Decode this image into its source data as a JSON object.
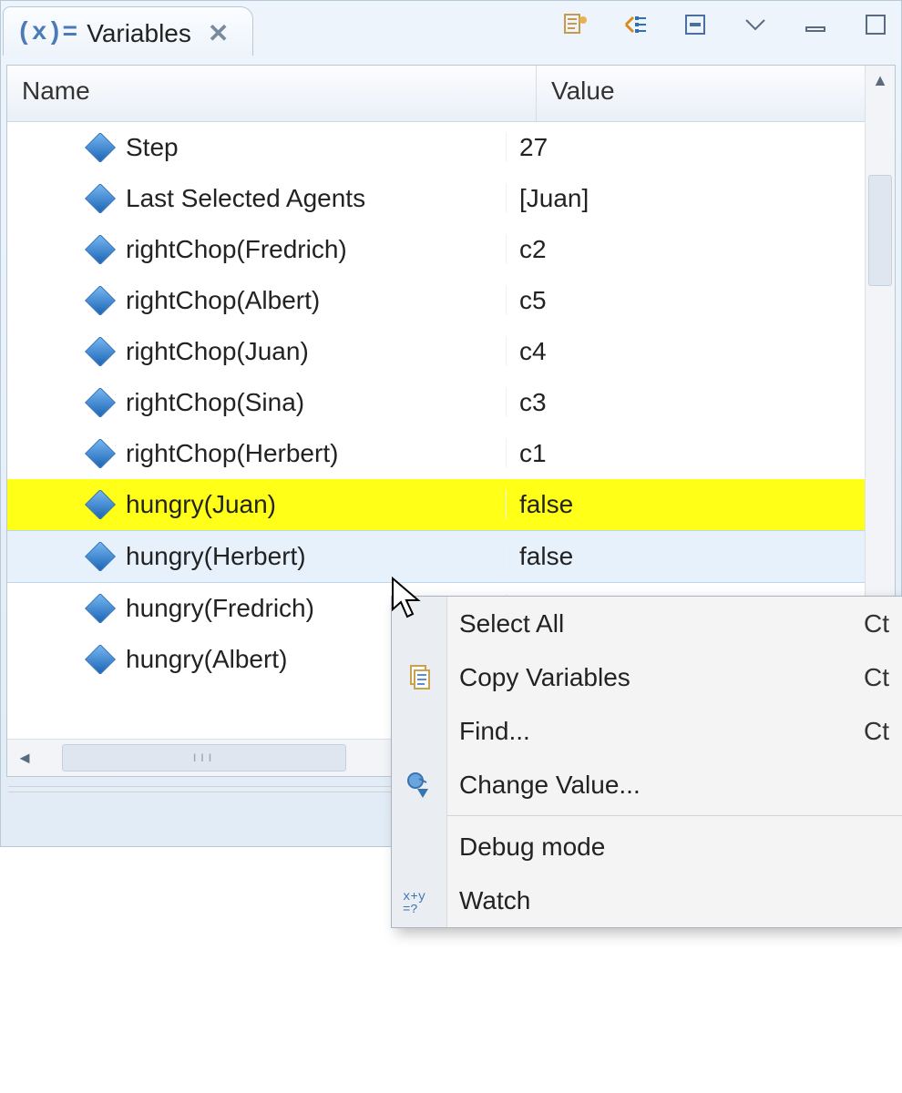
{
  "tab": {
    "title": "Variables",
    "icon": "(x)="
  },
  "toolbar": {
    "logical_structure": "show-logical-structure",
    "collapse_all": "collapse-all",
    "menu": "view-menu",
    "min": "minimize",
    "max": "maximize"
  },
  "columns": {
    "name": "Name",
    "value": "Value"
  },
  "rows": [
    {
      "name": "Step",
      "value": "27"
    },
    {
      "name": "Last Selected Agents",
      "value": "[Juan]"
    },
    {
      "name": "rightChop(Fredrich)",
      "value": "c2"
    },
    {
      "name": "rightChop(Albert)",
      "value": "c5"
    },
    {
      "name": "rightChop(Juan)",
      "value": "c4"
    },
    {
      "name": "rightChop(Sina)",
      "value": "c3"
    },
    {
      "name": "rightChop(Herbert)",
      "value": "c1"
    },
    {
      "name": "hungry(Juan)",
      "value": "false",
      "hl": true
    },
    {
      "name": "hungry(Herbert)",
      "value": "false",
      "sel": true
    },
    {
      "name": "hungry(Fredrich)",
      "value": ""
    },
    {
      "name": "hungry(Albert)",
      "value": ""
    }
  ],
  "context_menu": {
    "items": [
      {
        "icon": "",
        "label": "Select All",
        "shortcut": "Ct"
      },
      {
        "icon": "copy",
        "label": "Copy Variables",
        "shortcut": "Ct"
      },
      {
        "icon": "",
        "label": "Find...",
        "shortcut": "Ct"
      },
      {
        "icon": "change",
        "label": "Change Value...",
        "shortcut": ""
      },
      {
        "sep": true
      },
      {
        "icon": "",
        "label": "Debug mode",
        "shortcut": ""
      },
      {
        "icon": "watch",
        "label": "Watch",
        "shortcut": ""
      }
    ]
  }
}
